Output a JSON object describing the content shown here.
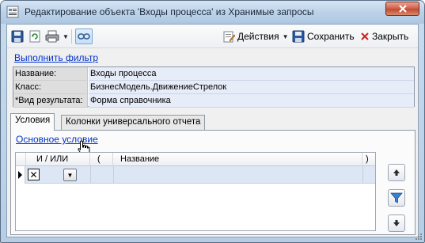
{
  "window": {
    "title": "Редактирование объекта 'Входы процесса' из Хранимые запросы"
  },
  "toolbar": {
    "save_icon": "floppy-disk-icon",
    "refresh_icon": "refresh-icon",
    "print_icon": "printer-icon",
    "link_icon": "link-icon",
    "actions_label": "Действия",
    "save_label": "Сохранить",
    "close_label": "Закрыть"
  },
  "filter_link": "Выполнить фильтр",
  "properties": [
    {
      "label": "Название:",
      "value": "Входы процесса"
    },
    {
      "label": "Класс:",
      "value": "БизнесМодель.ДвижениеСтрелок"
    },
    {
      "label": "*Вид результата:",
      "value": "Форма справочника"
    }
  ],
  "tabs": [
    {
      "label": "Условия",
      "active": true
    },
    {
      "label": "Колонки универсального отчета",
      "active": false
    }
  ],
  "conditions": {
    "link_label": "Основное условие",
    "columns": {
      "and_or": "И / ИЛИ",
      "open_paren": "(",
      "name": "Название",
      "close_paren": ")"
    },
    "row_checkbox_mark": "✕"
  },
  "side_buttons": [
    "move-up-icon",
    "filter-icon",
    "move-down-icon"
  ],
  "colors": {
    "link": "#0033cc",
    "selected_row": "#dce6f4",
    "close_button": "#c14a34"
  }
}
